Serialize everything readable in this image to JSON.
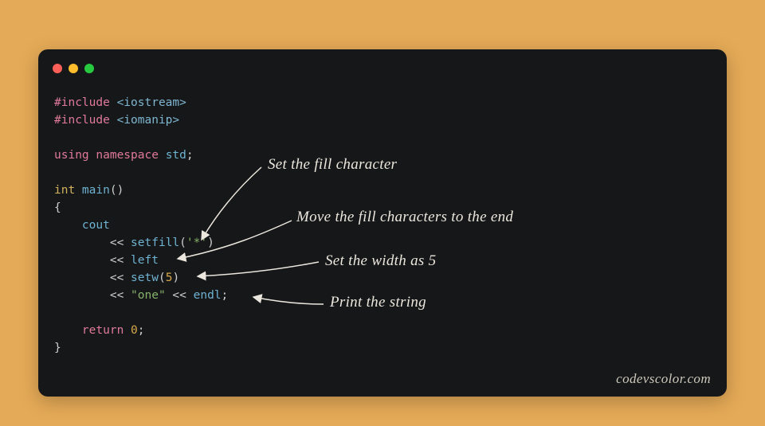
{
  "theme": {
    "page_bg": "#e5aa57",
    "window_bg": "#151718",
    "dot_red": "#ff5f56",
    "dot_yellow": "#ffbd2e",
    "dot_green": "#27c93f"
  },
  "code": {
    "include1_kw": "#include",
    "include1_hdr": " <iostream>",
    "include2_kw": "#include",
    "include2_hdr": " <iomanip>",
    "using_kw": "using",
    "namespace_kw": " namespace",
    "std_id": " std",
    "using_semi": ";",
    "int_type": "int",
    "main_fn": " main",
    "main_parens": "()",
    "brace_open": "{",
    "cout_indent": "    ",
    "cout_id": "cout",
    "ln_setfill_indent": "        ",
    "op": "<< ",
    "setfill_id": "setfill",
    "setfill_open": "(",
    "setfill_arg": "'*'",
    "setfill_close": ")",
    "left_id": "left",
    "setw_id": "setw",
    "setw_open": "(",
    "setw_arg": "5",
    "setw_close": ")",
    "one_str": "\"one\"",
    "space_op": " << ",
    "endl_id": "endl",
    "stmt_semi": ";",
    "return_indent": "    ",
    "return_kw": "return",
    "return_sp": " ",
    "zero": "0",
    "return_semi": ";",
    "brace_close": "}"
  },
  "annotations": {
    "a1": "Set the fill character",
    "a2": "Move the fill characters to the end",
    "a3": "Set the width as 5",
    "a4": "Print the string"
  },
  "watermark": "codevscolor.com"
}
